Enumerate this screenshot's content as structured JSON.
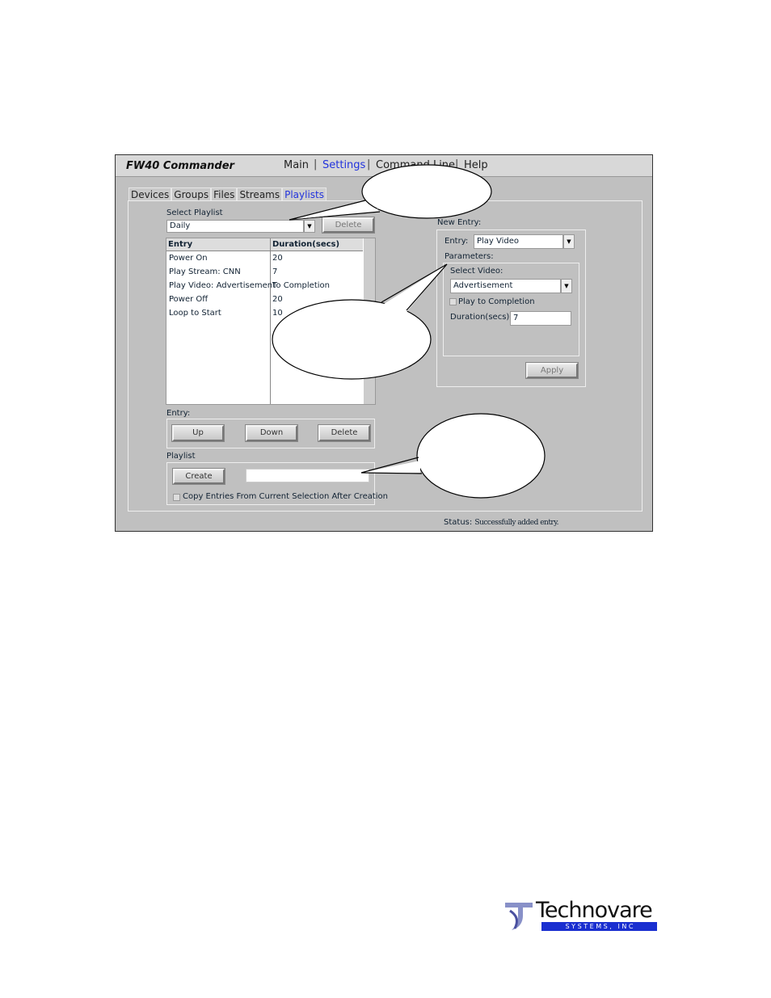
{
  "window": {
    "title": "FW40 Commander"
  },
  "menu": [
    {
      "label": "Main"
    },
    {
      "label": "Settings",
      "active": true
    },
    {
      "label": "Command Line"
    },
    {
      "label": "Help"
    }
  ],
  "tabs": [
    {
      "label": "Devices"
    },
    {
      "label": "Groups"
    },
    {
      "label": "Files"
    },
    {
      "label": "Streams"
    },
    {
      "label": "Playlists",
      "active": true
    }
  ],
  "select_playlist": {
    "label": "Select Playlist",
    "value": "Daily",
    "delete_label": "Delete"
  },
  "table": {
    "headers": [
      "Entry",
      "Duration(secs)"
    ],
    "rows": [
      [
        "Power On",
        "20"
      ],
      [
        "Play Stream: CNN",
        "7"
      ],
      [
        "Play Video: Advertisement",
        "To Completion"
      ],
      [
        "Power Off",
        "20"
      ],
      [
        "Loop to Start",
        "10"
      ]
    ]
  },
  "entry_group": {
    "label": "Entry:",
    "up": "Up",
    "down": "Down",
    "delete": "Delete"
  },
  "playlist_group": {
    "label": "Playlist",
    "create": "Create",
    "name_value": "",
    "copy_label": "Copy Entries From Current Selection After Creation",
    "copy_checked": false
  },
  "new_entry": {
    "label": "New Entry:",
    "entry_label": "Entry:",
    "entry_value": "Play Video",
    "parameters_label": "Parameters:",
    "select_video_label": "Select Video:",
    "select_video_value": "Advertisement",
    "play_to_completion_label": "Play to Completion",
    "play_to_completion_checked": false,
    "duration_label": "Duration(secs):",
    "duration_value": "7",
    "apply": "Apply"
  },
  "status": {
    "label": "Status:",
    "text": "Successfully added entry."
  },
  "logo": {
    "name": "Technovare",
    "sub": "S Y S T E M S ,   I N C",
    "colors": {
      "bar": "#1a2fd0",
      "mark": "#8890c8"
    }
  },
  "colors": {
    "accent": "#2233dd",
    "background": "#c0c0c0"
  }
}
